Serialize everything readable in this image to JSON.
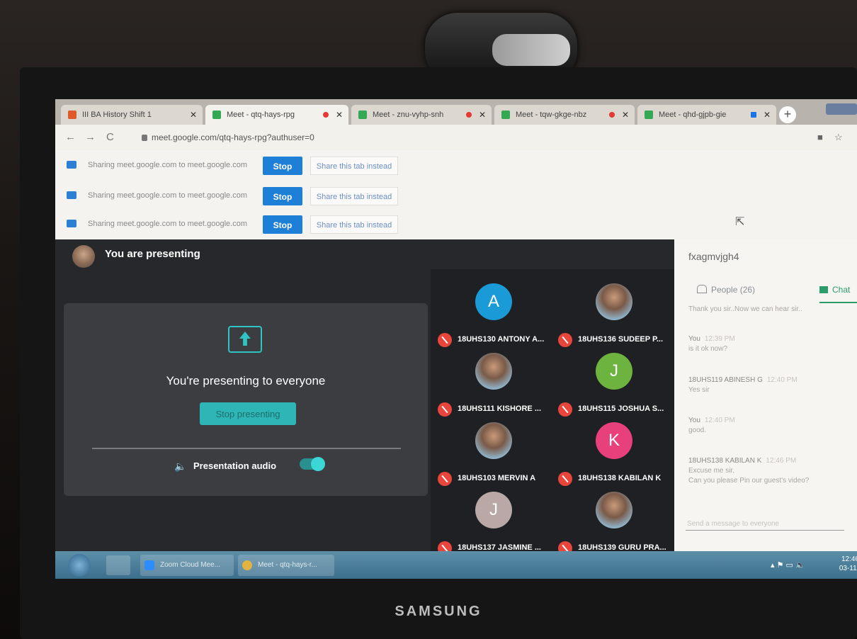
{
  "monitor": {
    "brand": "SAMSUNG"
  },
  "browser": {
    "tabs": [
      {
        "title": "III BA History Shift 1",
        "active": false
      },
      {
        "title": "Meet - qtq-hays-rpg",
        "active": true
      },
      {
        "title": "Meet - znu-vyhp-snh",
        "active": false
      },
      {
        "title": "Meet - tqw-gkge-nbz",
        "active": false
      },
      {
        "title": "Meet - qhd-gjpb-gie",
        "active": false
      }
    ],
    "new_tab": "+",
    "url": "meet.google.com/qtq-hays-rpg?authuser=0",
    "nav": {
      "back": "←",
      "forward": "→",
      "reload": "C"
    }
  },
  "sharing_bars": [
    {
      "text": "Sharing meet.google.com to meet.google.com",
      "stop": "Stop",
      "instead": "Share this tab instead"
    },
    {
      "text": "Sharing meet.google.com to meet.google.com",
      "stop": "Stop",
      "instead": "Share this tab instead"
    },
    {
      "text": "Sharing meet.google.com to meet.google.com",
      "stop": "Stop",
      "instead": "Share this tab instead"
    }
  ],
  "meet": {
    "presenting_title": "You are presenting",
    "card_title": "You're presenting to everyone",
    "stop_presenting": "Stop presenting",
    "audio_label": "Presentation audio",
    "audio_on": true
  },
  "participants": [
    {
      "name": "18UHS130 ANTONY A...",
      "initial": "A",
      "color": "#1a9bd8"
    },
    {
      "name": "18UHS136 SUDEEP P...",
      "initial": "",
      "color": "photo"
    },
    {
      "name": "18UHS111 KISHORE ...",
      "initial": "",
      "color": "photo"
    },
    {
      "name": "18UHS115 JOSHUA S...",
      "initial": "J",
      "color": "#6db33f"
    },
    {
      "name": "18UHS103 MERVIN A",
      "initial": "",
      "color": "photo"
    },
    {
      "name": "18UHS138 KABILAN K",
      "initial": "K",
      "color": "#e8407a"
    },
    {
      "name": "18UHS137 JASMINE ...",
      "initial": "J",
      "color": "#b9a8a6"
    },
    {
      "name": "18UHS139 GURU PRA...",
      "initial": "",
      "color": "photo"
    }
  ],
  "side_panel": {
    "meeting_code": "fxagmvjgh4",
    "people_tab": "People (26)",
    "chat_tab": "Chat",
    "messages": [
      {
        "sender": "",
        "time": "",
        "text": "Thank you sir..Now we can hear sir.."
      },
      {
        "sender": "You",
        "time": "12:39 PM",
        "text": "is it ok now?"
      },
      {
        "sender": "18UHS119 ABINESH G",
        "time": "12:40 PM",
        "text": "Yes sir"
      },
      {
        "sender": "You",
        "time": "12:40 PM",
        "text": "good."
      },
      {
        "sender": "18UHS138 KABILAN K",
        "time": "12:46 PM",
        "text": "Excuse me sir,"
      },
      {
        "sender": "",
        "time": "",
        "text": "Can you please Pin our guest's video?"
      }
    ],
    "input_placeholder": "Send a message to everyone"
  },
  "taskbar": {
    "items": [
      {
        "label": "Zoom Cloud Mee..."
      },
      {
        "label": "Meet - qtq-hays-r..."
      }
    ],
    "clock_time": "12:46",
    "clock_date": "03-11-"
  }
}
